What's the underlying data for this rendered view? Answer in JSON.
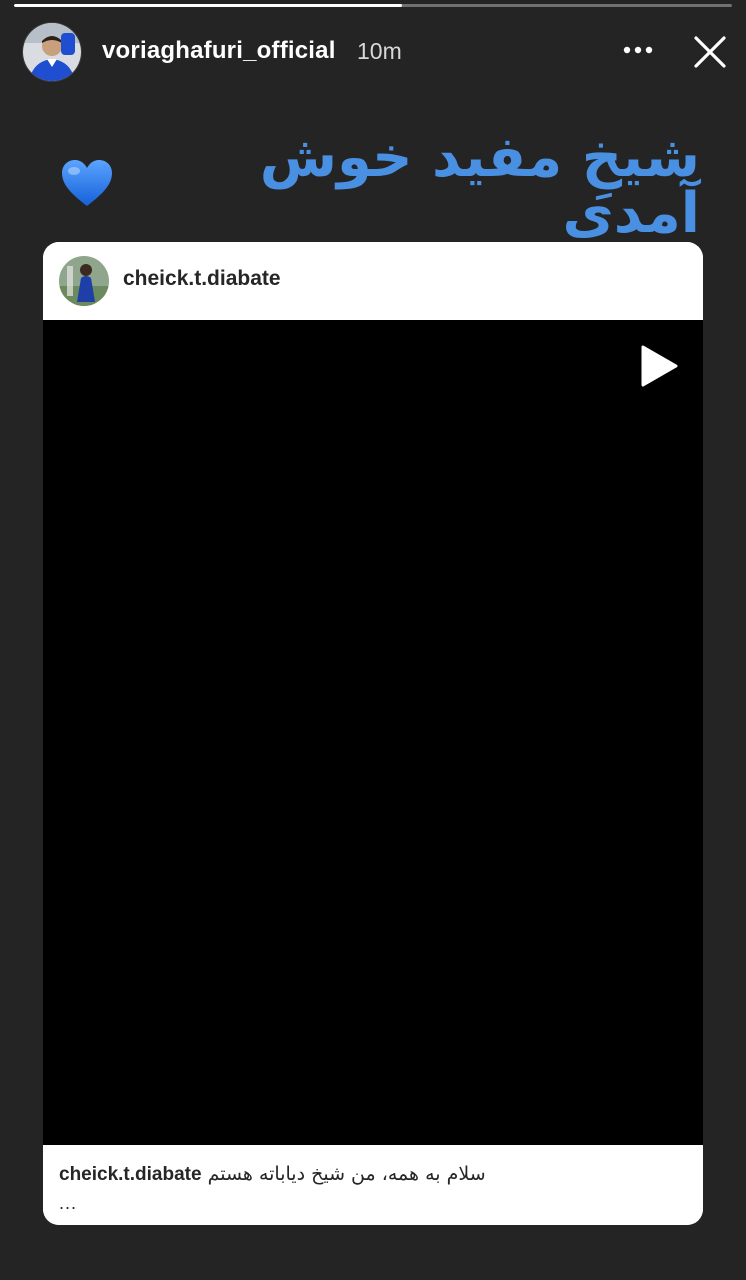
{
  "story": {
    "progress": 0.54,
    "username": "voriaghafuri_official",
    "timestamp": "10m",
    "more_icon": "more-horizontal-icon",
    "close_icon": "close-icon"
  },
  "caption": {
    "text": "شیخِ مفید خوش آمدی",
    "emoji": "blue-heart-icon",
    "color": "#4a90e2"
  },
  "shared_post": {
    "username": "cheick.t.diabate",
    "media_icon": "play-icon",
    "footer_username": "cheick.t.diabate",
    "footer_caption": "سلام به همه، من شیخ دیاباته هستم",
    "footer_more": "..."
  }
}
